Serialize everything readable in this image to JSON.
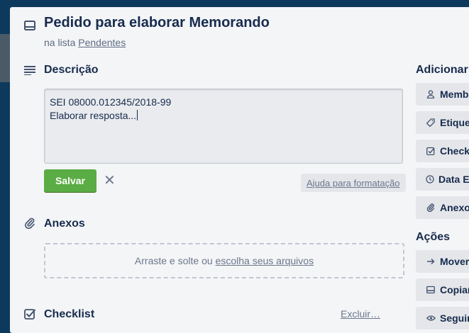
{
  "card": {
    "title": "Pedido para elaborar Memorando",
    "list_prefix": "na lista",
    "list_name": "Pendentes"
  },
  "description": {
    "heading": "Descrição",
    "line1": "SEI 08000.012345/2018-99",
    "line2": "Elaborar resposta...",
    "save_label": "Salvar",
    "close_symbol": "✕",
    "format_help": "Ajuda para formatação"
  },
  "attachments": {
    "heading": "Anexos",
    "drop_text": "Arraste e solte ou",
    "drop_link": "escolha seus arquivos"
  },
  "checklist": {
    "heading": "Checklist",
    "delete_label": "Excluir…"
  },
  "sidebar": {
    "add_heading": "Adicionar",
    "add_items": [
      {
        "label": "Membros",
        "icon": "person-icon"
      },
      {
        "label": "Etiquetas",
        "icon": "tag-icon"
      },
      {
        "label": "Checklist",
        "icon": "checkbox-icon"
      },
      {
        "label": "Data Entrega",
        "icon": "clock-icon"
      },
      {
        "label": "Anexo",
        "icon": "paperclip-icon"
      }
    ],
    "actions_heading": "Ações",
    "action_items": [
      {
        "label": "Mover",
        "icon": "arrow-right-icon"
      },
      {
        "label": "Copiar",
        "icon": "card-icon"
      },
      {
        "label": "Seguir",
        "icon": "eye-icon"
      }
    ]
  },
  "colors": {
    "save_button": "#5aac44",
    "background": "#0d3a5c",
    "modal": "#f4f5f7"
  }
}
